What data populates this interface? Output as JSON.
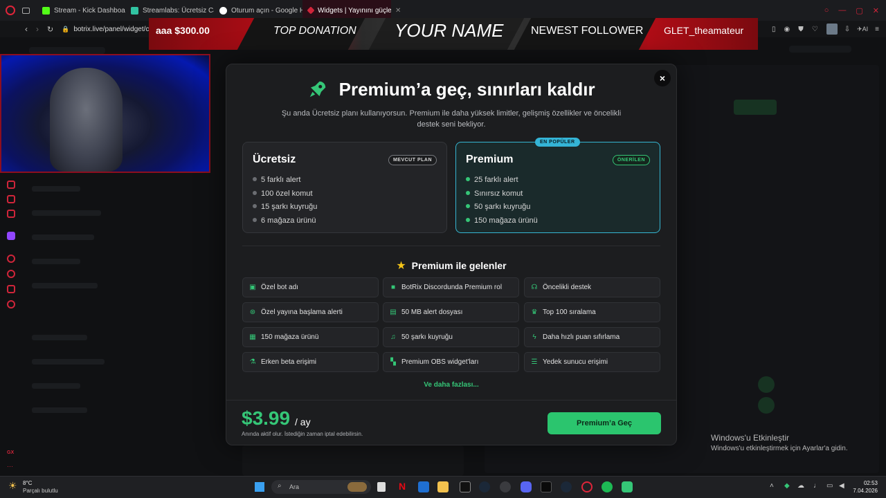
{
  "browser": {
    "tabs": [
      {
        "label": "Stream - Kick Dashboard",
        "color": "#53fc18"
      },
      {
        "label": "Streamlabs: Ücretsiz Cank",
        "color": "#31c3a2"
      },
      {
        "label": "Oturum açın - Google Hes",
        "color": "#ffffff"
      },
      {
        "label": "Widgets | Yayınını güçlend",
        "color": "#d0253a"
      }
    ],
    "url": "botrix.live/panel/widget/chat"
  },
  "overlay": {
    "donation_amount": "aaa $300.00",
    "top_donation": "TOP DONATION",
    "your_name": "YOUR NAME",
    "newest_follower": "NEWEST FOLLOWER",
    "follower_name": "GLET_theamateur"
  },
  "modal": {
    "title": "Premium’a geç, sınırları kaldır",
    "subtitle": "Şu anda Ücretsiz planı kullanıyorsun. Premium ile daha yüksek limitler, gelişmiş özellikler ve öncelikli destek seni bekliyor.",
    "free_plan": {
      "name": "Ücretsiz",
      "badge": "MEVCUT PLAN",
      "features": [
        "5 farklı alert",
        "100 özel komut",
        "15 şarkı kuyruğu",
        "6 mağaza ürünü"
      ]
    },
    "premium_plan": {
      "name": "Premium",
      "badge": "ÖNERİLEN",
      "popular": "EN POPÜLER",
      "features": [
        "25 farklı alert",
        "Sınırsız komut",
        "50 şarkı kuyruğu",
        "150 mağaza ürünü"
      ]
    },
    "section_title": "Premium ile gelenler",
    "perks": [
      {
        "label": "Özel bot adı",
        "icon": "bot-icon"
      },
      {
        "label": "BotRix Discordunda Premium rol",
        "icon": "discord-icon"
      },
      {
        "label": "Öncelikli destek",
        "icon": "headset-icon"
      },
      {
        "label": "Özel yayına başlama alerti",
        "icon": "broadcast-icon"
      },
      {
        "label": "50 MB alert dosyası",
        "icon": "file-icon"
      },
      {
        "label": "Top 100 sıralama",
        "icon": "trophy-icon"
      },
      {
        "label": "150 mağaza ürünü",
        "icon": "store-icon"
      },
      {
        "label": "50 şarkı kuyruğu",
        "icon": "music-icon"
      },
      {
        "label": "Daha hızlı puan sıfırlama",
        "icon": "bolt-icon"
      },
      {
        "label": "Erken beta erişimi",
        "icon": "flask-icon"
      },
      {
        "label": "Premium OBS widget'ları",
        "icon": "widgets-icon"
      },
      {
        "label": "Yedek sunucu erişimi",
        "icon": "server-icon"
      }
    ],
    "more_link": "Ve daha fazlası...",
    "price": "$3.99",
    "per": "/ ay",
    "price_note": "Anında aktif olur. İstediğin zaman iptal edebilirsin.",
    "cta": "Premium’a Geç",
    "close": "×"
  },
  "windows_activation": {
    "title": "Windows'u Etkinleştir",
    "subtitle": "Windows'u etkinleştirmek için Ayarlar'a gidin."
  },
  "taskbar": {
    "weather_temp": "8°C",
    "weather_desc": "Parçalı bulutlu",
    "search_placeholder": "Ara",
    "time": "02:53",
    "date": "7.04.2026"
  },
  "colors": {
    "accent_green": "#35c677",
    "accent_blue": "#36b7d3",
    "brand_red": "#d0253a"
  }
}
